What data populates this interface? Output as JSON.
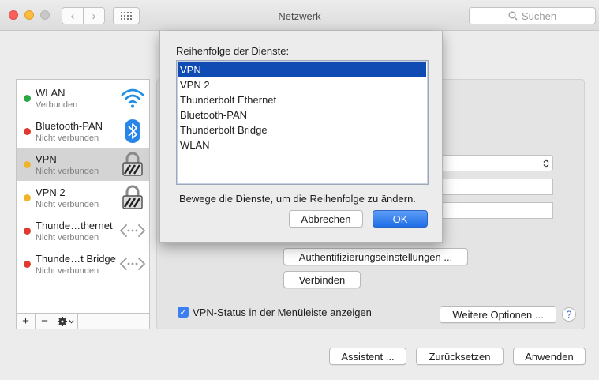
{
  "window": {
    "title": "Netzwerk",
    "search_placeholder": "Suchen"
  },
  "sidebar": {
    "services": [
      {
        "name": "WLAN",
        "status": "Verbunden",
        "dot_color": "#28a745",
        "icon": "wifi-icon"
      },
      {
        "name": "Bluetooth-PAN",
        "status": "Nicht verbunden",
        "dot_color": "#e0392f",
        "icon": "bluetooth-icon"
      },
      {
        "name": "VPN",
        "status": "Nicht verbunden",
        "dot_color": "#f0b429",
        "icon": "lock-icon",
        "selected": true
      },
      {
        "name": "VPN 2",
        "status": "Nicht verbunden",
        "dot_color": "#f0b429",
        "icon": "lock-icon"
      },
      {
        "name": "Thunde…thernet",
        "status": "Nicht verbunden",
        "dot_color": "#e0392f",
        "icon": "thunderbolt-icon"
      },
      {
        "name": "Thunde…t Bridge",
        "status": "Nicht verbunden",
        "dot_color": "#e0392f",
        "icon": "thunderbolt-icon"
      }
    ],
    "footer": {
      "add": "+",
      "remove": "−"
    }
  },
  "main": {
    "auth_button": "Authentifizierungseinstellungen ...",
    "connect_button": "Verbinden",
    "vpn_status_label": "VPN-Status in der Menüleiste anzeigen",
    "vpn_status_checked": true,
    "more_options_button": "Weitere Optionen ...",
    "help": "?"
  },
  "bottom": {
    "assistant": "Assistent ...",
    "reset": "Zurücksetzen",
    "apply": "Anwenden"
  },
  "sheet": {
    "title": "Reihenfolge der Dienste:",
    "items": [
      "VPN",
      "VPN 2",
      "Thunderbolt Ethernet",
      "Bluetooth-PAN",
      "Thunderbolt Bridge",
      "WLAN"
    ],
    "selected_index": 0,
    "hint": "Bewege die Dienste, um die Reihenfolge zu ändern.",
    "cancel": "Abbrechen",
    "ok": "OK"
  },
  "colors": {
    "accent": "#1f6ee6",
    "selection": "#0f4bb3"
  }
}
